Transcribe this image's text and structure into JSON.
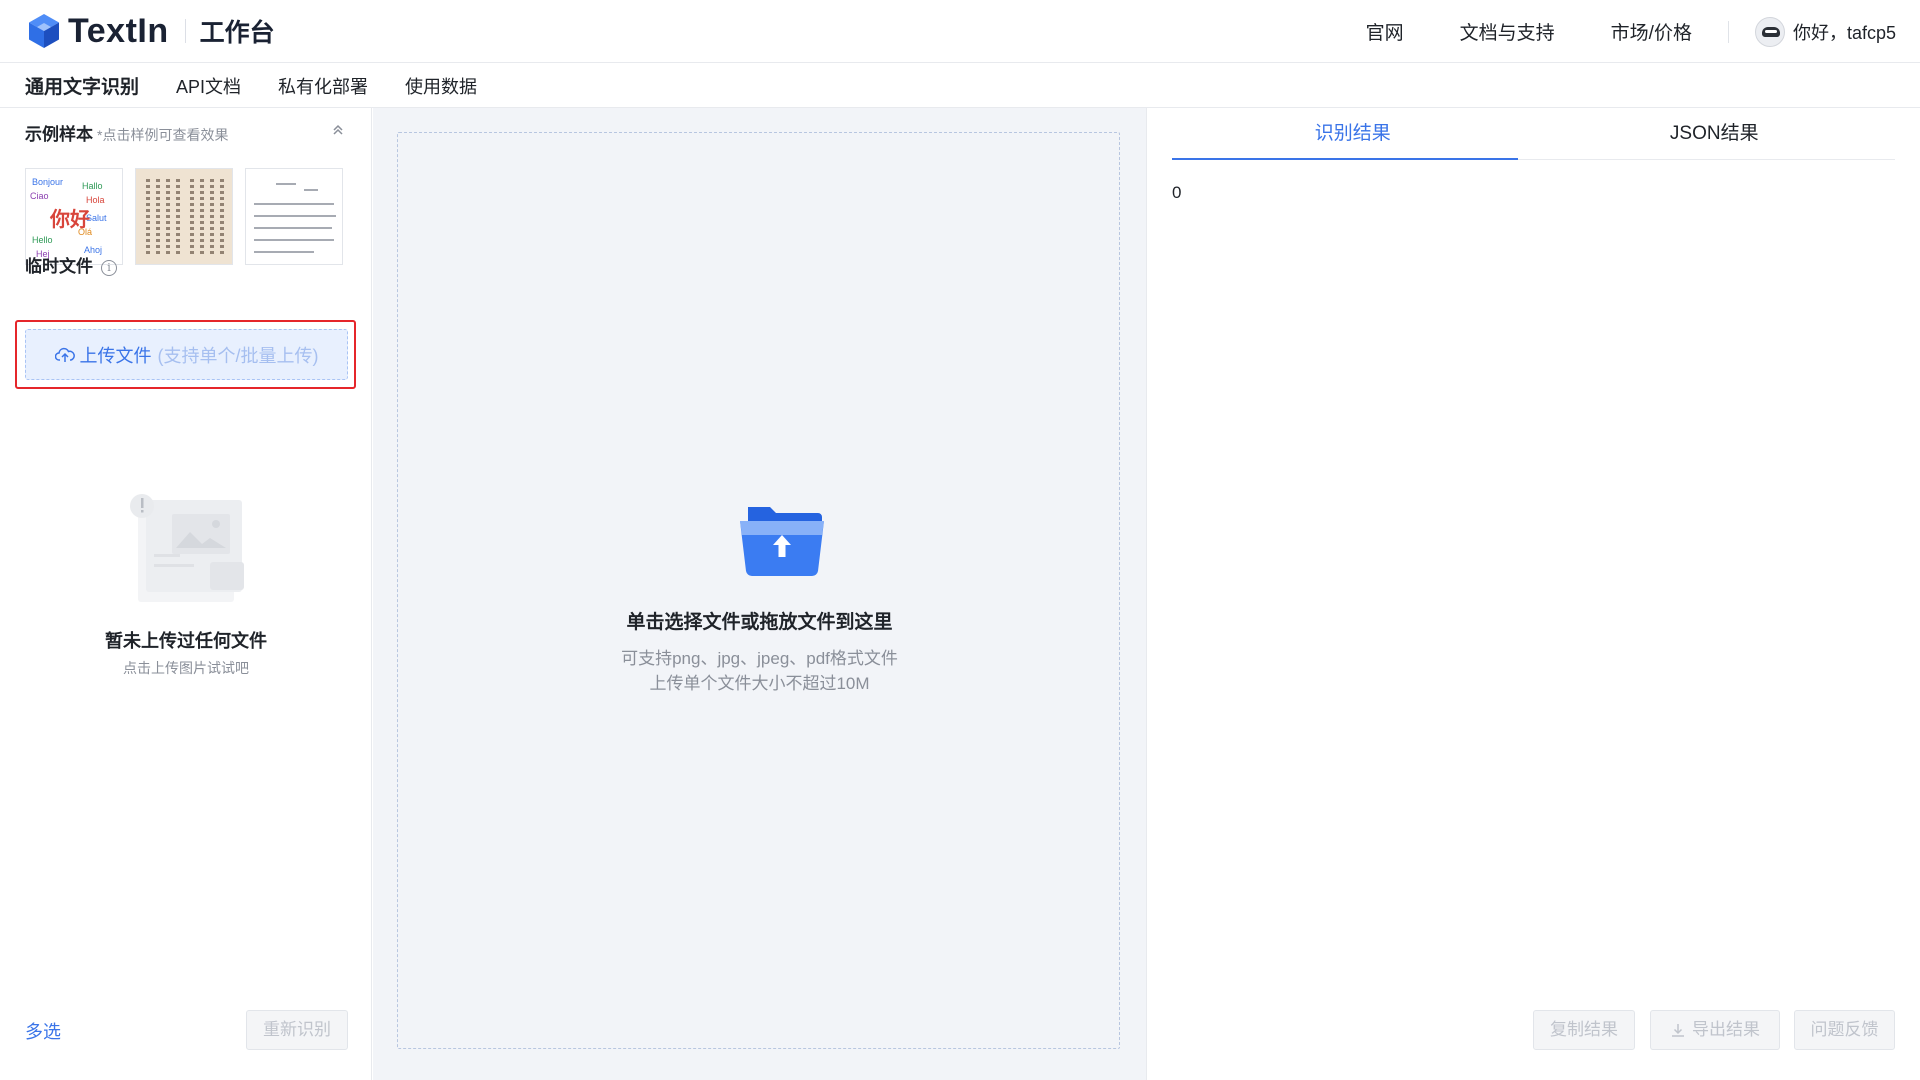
{
  "header": {
    "logo_text": "TextIn",
    "logo_sub": "工作台",
    "nav": [
      "官网",
      "文档与支持",
      "市场/价格"
    ],
    "greeting": "你好，tafcp5"
  },
  "subnav": {
    "tabs": [
      "通用文字识别",
      "API文档",
      "私有化部署",
      "使用数据"
    ]
  },
  "left": {
    "samples_title": "示例样本",
    "samples_hint": "*点击样例可查看效果",
    "sample_word": "你好",
    "temp_title": "临时文件",
    "upload_label": "上传文件",
    "upload_sub": "(支持单个/批量上传)",
    "empty_title": "暂未上传过任何文件",
    "empty_sub": "点击上传图片试试吧",
    "multi_select": "多选",
    "re_recognize": "重新识别"
  },
  "middle": {
    "drop_title": "单击选择文件或拖放文件到这里",
    "drop_formats": "可支持png、jpg、jpeg、pdf格式文件",
    "drop_size": "上传单个文件大小不超过10M"
  },
  "right": {
    "tabs": [
      "识别结果",
      "JSON结果"
    ],
    "result_text": "0",
    "copy_result": "复制结果",
    "export_result": "导出结果",
    "feedback": "问题反馈"
  },
  "colors": {
    "accent": "#3a74e8",
    "highlight_border": "#e5262b"
  }
}
